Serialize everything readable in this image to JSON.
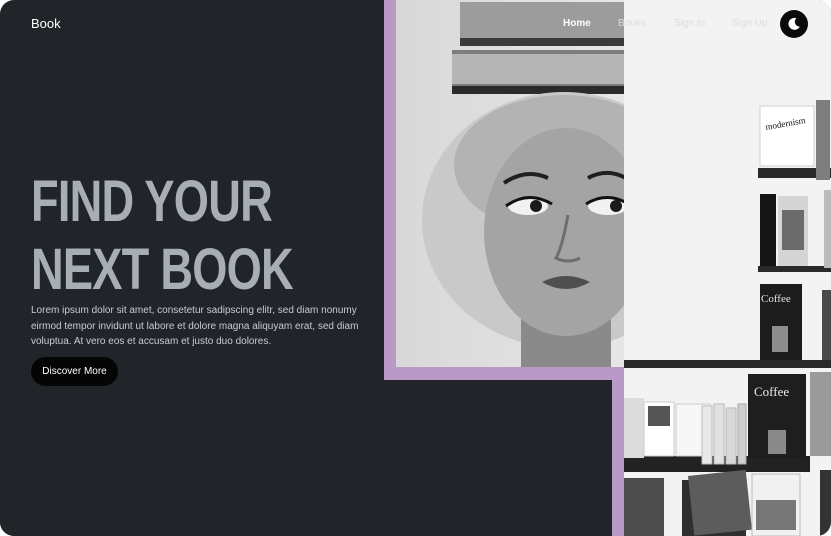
{
  "header": {
    "brand": "Book",
    "nav": [
      {
        "label": "Home",
        "active": true
      },
      {
        "label": "Books",
        "active": false
      },
      {
        "label": "Sign In",
        "active": false
      },
      {
        "label": "Sign Up",
        "active": false
      }
    ],
    "theme_toggle_icon": "moon-icon"
  },
  "hero": {
    "title_line1": "FIND YOUR",
    "title_line2": "NEXT BOOK",
    "description": "Lorem ipsum dolor sit amet, consetetur sadipscing elitr, sed diam nonumy eirmod tempor invidunt ut labore et dolore magna aliquyam erat, sed diam voluptua. At vero eos et accusam et justo duo dolores.",
    "cta_label": "Discover More"
  },
  "photos": {
    "shelf_titles": [
      "modernism",
      "Coffee",
      "Coffee"
    ]
  },
  "colors": {
    "background": "#212429",
    "accent": "#b99ac6",
    "title": "#a8aeb6"
  }
}
